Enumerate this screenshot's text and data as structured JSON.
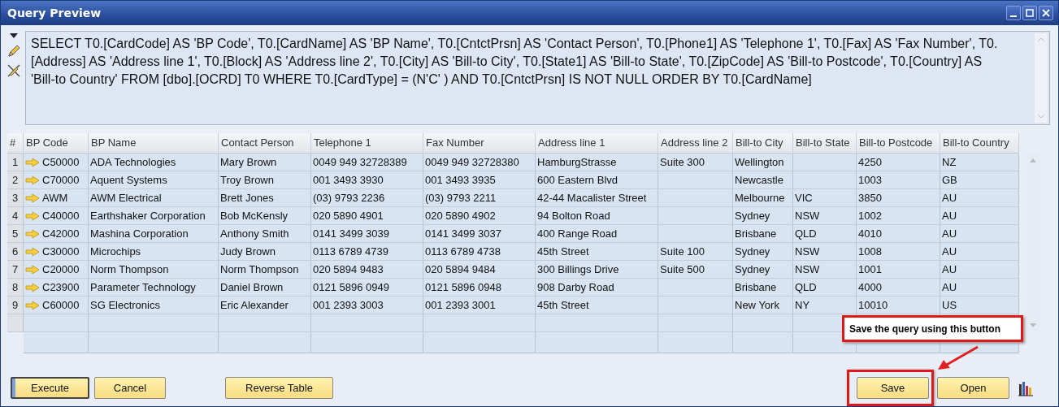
{
  "window": {
    "title": "Query Preview"
  },
  "query": {
    "text": "SELECT T0.[CardCode] AS 'BP Code', T0.[CardName] AS 'BP Name', T0.[CntctPrsn] AS 'Contact Person', T0.[Phone1] AS 'Telephone 1', T0.[Fax] AS 'Fax Number', T0.[Address] AS 'Address line 1', T0.[Block] AS 'Address line 2', T0.[City] AS 'Bill-to City', T0.[State1] AS 'Bill-to State', T0.[ZipCode] AS 'Bill-to Postcode', T0.[Country] AS 'Bill-to Country' FROM  [dbo].[OCRD] T0  WHERE T0.[CardType] = (N'C' )  AND  T0.[CntctPrsn] IS NOT NULL    ORDER BY T0.[CardName]"
  },
  "table": {
    "columns": [
      "#",
      "BP Code",
      "BP Name",
      "Contact Person",
      "Telephone 1",
      "Fax Number",
      "Address line 1",
      "Address line 2",
      "Bill-to City",
      "Bill-to State",
      "Bill-to Postcode",
      "Bill-to Country"
    ],
    "rows": [
      [
        "1",
        "C50000",
        "ADA Technologies",
        "Mary Brown",
        "0049 949 32728389",
        "0049 949 32728380",
        "HamburgStrasse",
        "Suite 300",
        "Wellington",
        "",
        "4250",
        "NZ"
      ],
      [
        "2",
        "C70000",
        "Aquent Systems",
        "Troy Brown",
        "001 3493 3930",
        "001 3493 3935",
        "600 Eastern Blvd",
        "",
        "Newcastle",
        "",
        "1003",
        "GB"
      ],
      [
        "3",
        "AWM",
        "AWM Electrical",
        "Brett Jones",
        "(03) 9793 2236",
        "(03) 9793 2211",
        "42-44 Macalister Street",
        "",
        "Melbourne",
        "VIC",
        "3850",
        "AU"
      ],
      [
        "4",
        "C40000",
        "Earthshaker Corporation",
        "Bob McKensly",
        "020 5890 4901",
        "020 5890 4902",
        "94 Bolton Road",
        "",
        "Sydney",
        "NSW",
        "1002",
        "AU"
      ],
      [
        "5",
        "C42000",
        "Mashina Corporation",
        "Anthony Smith",
        "0141 3499 3039",
        "0141 3499 3037",
        "400 Range Road",
        "",
        "Brisbane",
        "QLD",
        "4010",
        "AU"
      ],
      [
        "6",
        "C30000",
        "Microchips",
        "Judy Brown",
        "0113 6789 4739",
        "0113 6789 4738",
        "45th Street",
        "Suite 100",
        "Sydney",
        "NSW",
        "1008",
        "AU"
      ],
      [
        "7",
        "C20000",
        "Norm Thompson",
        "Norm Thompson",
        "020 5894 9483",
        "020 5894 9484",
        "300 Billings Drive",
        "Suite 500",
        "Sydney",
        "NSW",
        "1001",
        "AU"
      ],
      [
        "8",
        "C23900",
        "Parameter Technology",
        "Daniel Brown",
        "0121 5896 0949",
        "0121 5896 0948",
        "908 Darby Road",
        "",
        "Brisbane",
        "QLD",
        "4000",
        "AU"
      ],
      [
        "9",
        "C60000",
        "SG Electronics",
        "Eric Alexander",
        "001 2393 3003",
        "001 2393 3001",
        "45th Street",
        "",
        "New York",
        "NY",
        "10010",
        "US"
      ]
    ]
  },
  "buttons_left": [
    {
      "label": "Execute",
      "focused": true
    },
    {
      "label": "Cancel",
      "focused": false
    },
    {
      "label": "Reverse Table",
      "focused": false
    }
  ],
  "buttons_right": [
    {
      "label": "Save",
      "highlighted": true
    },
    {
      "label": "Open",
      "highlighted": false
    }
  ],
  "callout": {
    "text": "Save the query using this button"
  }
}
